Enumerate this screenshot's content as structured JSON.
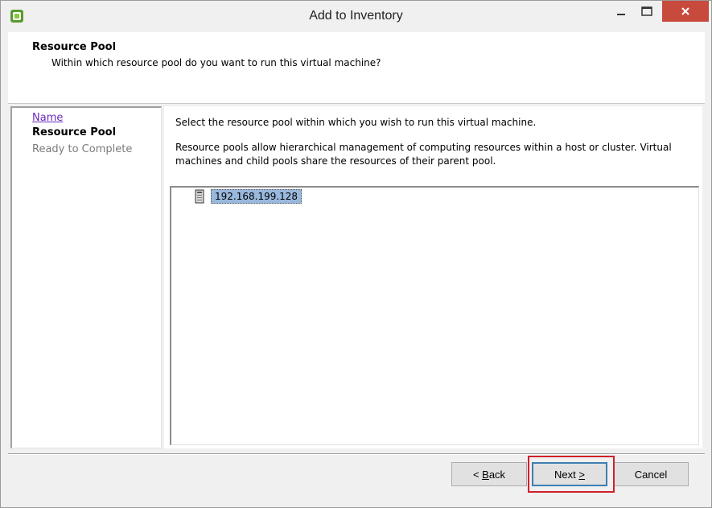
{
  "window": {
    "title": "Add to Inventory"
  },
  "header": {
    "title": "Resource Pool",
    "subtitle": "Within which resource pool do you want to run this virtual machine?"
  },
  "steps": [
    {
      "label": "Name",
      "state": "completed-link"
    },
    {
      "label": "Resource Pool",
      "state": "current"
    },
    {
      "label": "Ready to Complete",
      "state": "pending"
    }
  ],
  "content": {
    "instruction": "Select the resource pool within which you wish to run this virtual machine.",
    "description": "Resource pools allow hierarchical management of computing resources within a host or cluster. Virtual machines and child pools share the resources of their parent pool."
  },
  "tree": {
    "items": [
      {
        "label": "192.168.199.128",
        "icon": "host-icon",
        "selected": true
      }
    ]
  },
  "buttons": {
    "back": {
      "mnemonic": "B",
      "rest": "ack",
      "prefix": "< "
    },
    "next": {
      "text": "Next ",
      "mnemonic": ">"
    },
    "cancel": "Cancel"
  },
  "colors": {
    "highlight_box": "#d01f2a",
    "selection": "#99b8dd",
    "link": "#6a2bbf",
    "close_button": "#c74a3d"
  }
}
